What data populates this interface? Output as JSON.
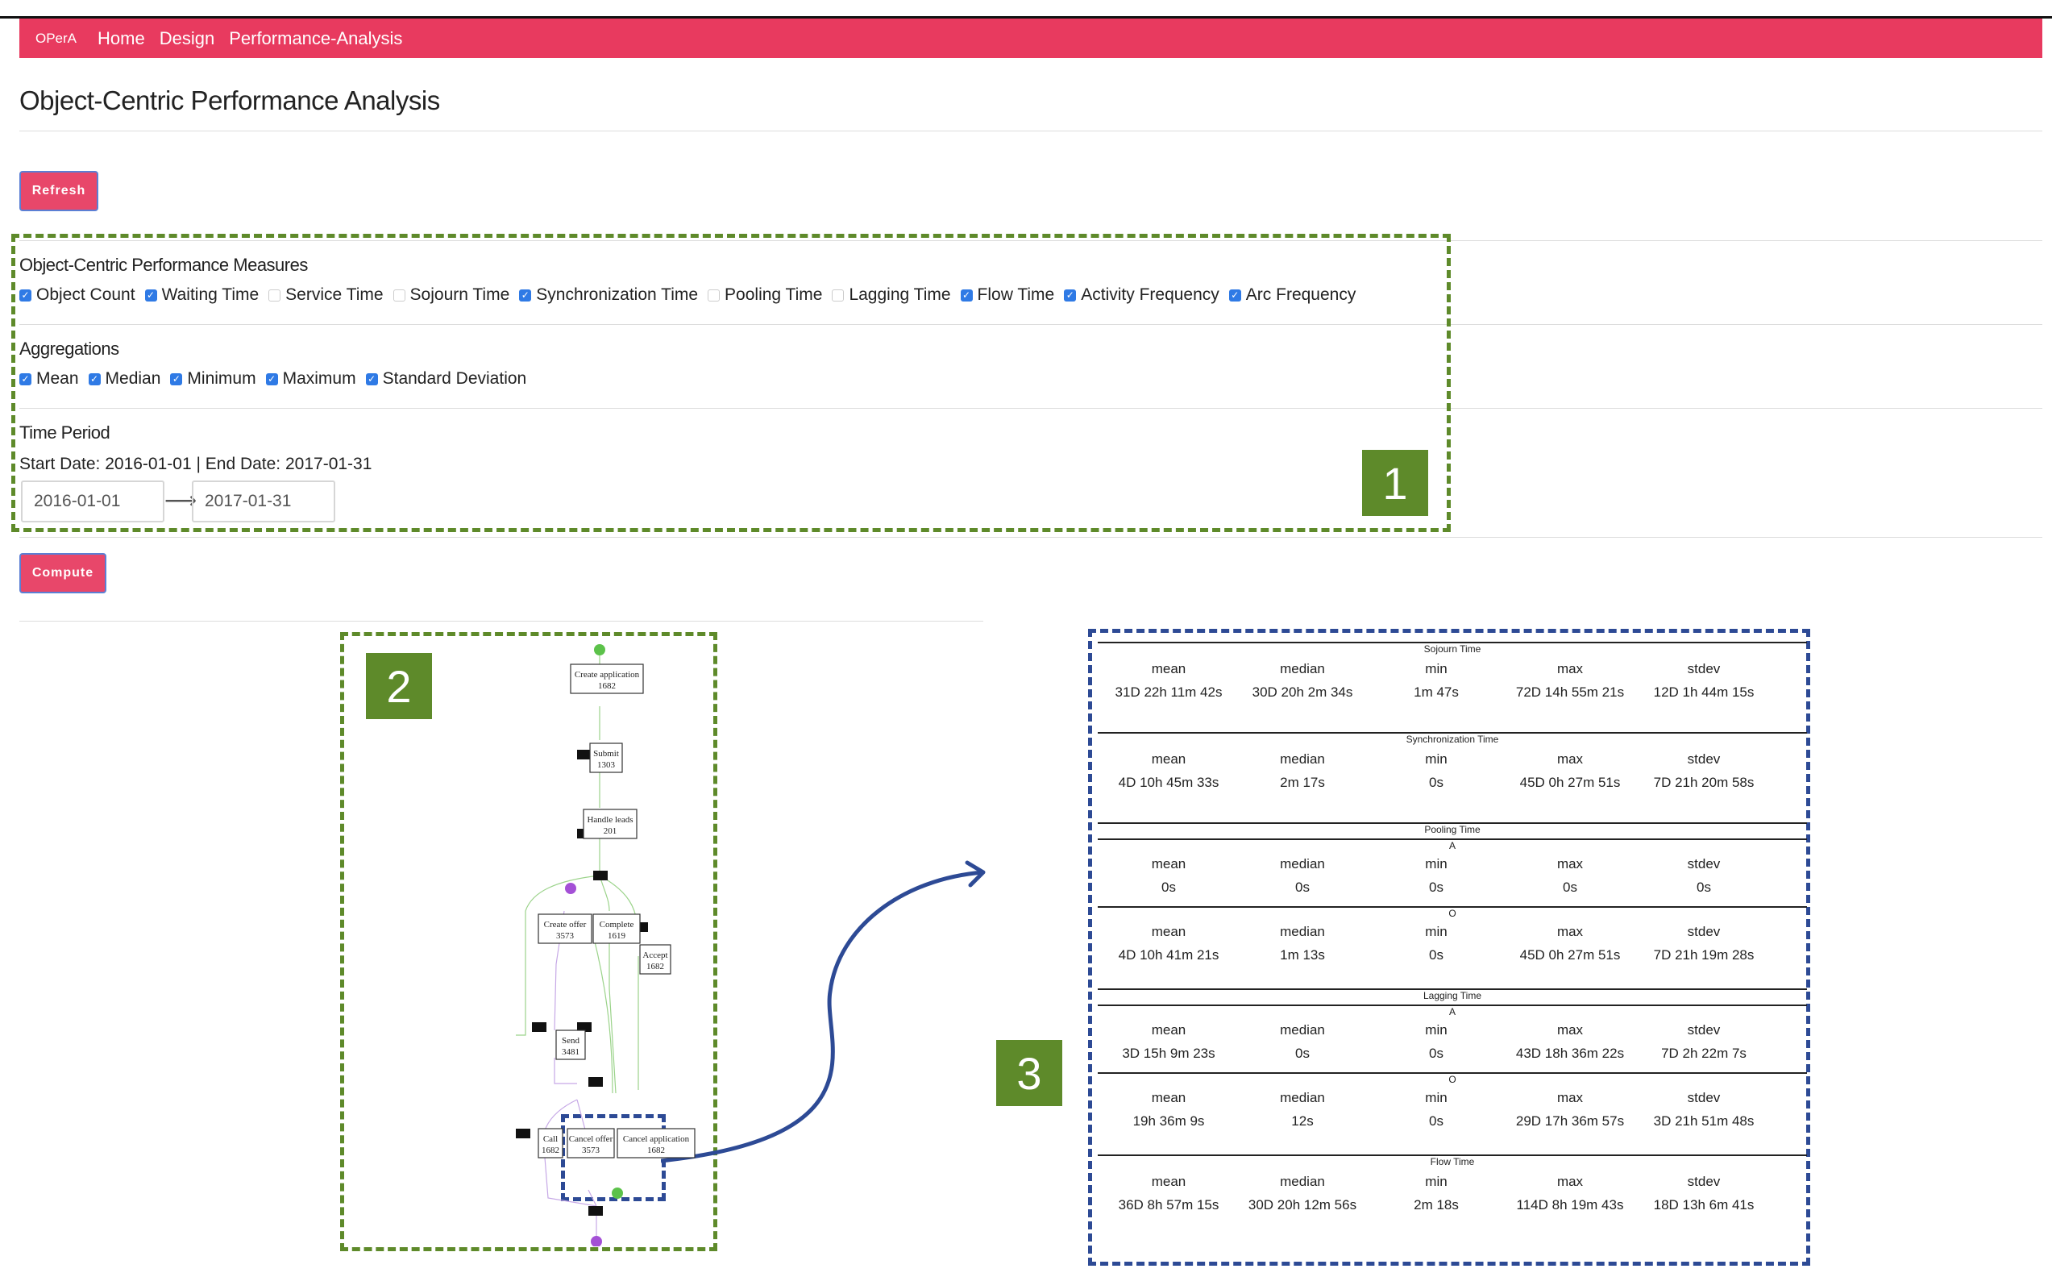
{
  "nav": {
    "brand": "OPerA",
    "links": [
      "Home",
      "Design",
      "Performance-Analysis"
    ]
  },
  "page_title": "Object-Centric Performance Analysis",
  "buttons": {
    "refresh": "Refresh",
    "compute": "Compute"
  },
  "measures": {
    "title": "Object-Centric Performance Measures",
    "items": [
      {
        "label": "Object Count",
        "checked": true
      },
      {
        "label": "Waiting Time",
        "checked": true
      },
      {
        "label": "Service Time",
        "checked": false
      },
      {
        "label": "Sojourn Time",
        "checked": false
      },
      {
        "label": "Synchronization Time",
        "checked": true
      },
      {
        "label": "Pooling Time",
        "checked": false
      },
      {
        "label": "Lagging Time",
        "checked": false
      },
      {
        "label": "Flow Time",
        "checked": true
      },
      {
        "label": "Activity Frequency",
        "checked": true
      },
      {
        "label": "Arc Frequency",
        "checked": true
      }
    ]
  },
  "aggregations": {
    "title": "Aggregations",
    "items": [
      {
        "label": "Mean",
        "checked": true
      },
      {
        "label": "Median",
        "checked": true
      },
      {
        "label": "Minimum",
        "checked": true
      },
      {
        "label": "Maximum",
        "checked": true
      },
      {
        "label": "Standard Deviation",
        "checked": true
      }
    ]
  },
  "time_period": {
    "title": "Time Period",
    "summary": "Start Date: 2016-01-01 | End Date: 2017-01-31",
    "start": "2016-01-01",
    "end": "2017-01-31"
  },
  "badges": [
    "1",
    "2",
    "3"
  ],
  "graph": {
    "nodes": [
      {
        "label": "Create application",
        "count": "1682"
      },
      {
        "label": "Submit",
        "count": "1303"
      },
      {
        "label": "Handle leads",
        "count": "201"
      },
      {
        "label": "Create offer",
        "count": "3573"
      },
      {
        "label": "Complete",
        "count": "1619"
      },
      {
        "label": "Accept",
        "count": "1682"
      },
      {
        "label": "Send",
        "count": "3481"
      },
      {
        "label": "Call",
        "count": "1682"
      },
      {
        "label": "Cancel offer",
        "count": "3573"
      },
      {
        "label": "Cancel application",
        "count": "1682"
      }
    ]
  },
  "performance": {
    "headers": [
      "mean",
      "median",
      "min",
      "max",
      "stdev"
    ],
    "sections": [
      {
        "title": "Sojourn Time",
        "groups": [
          {
            "sub": "",
            "values": [
              "31D 22h 11m 42s",
              "30D 20h 2m 34s",
              "1m 47s",
              "72D 14h 55m 21s",
              "12D 1h 44m 15s"
            ]
          }
        ]
      },
      {
        "title": "Synchronization Time",
        "groups": [
          {
            "sub": "",
            "values": [
              "4D 10h 45m 33s",
              "2m 17s",
              "0s",
              "45D 0h 27m 51s",
              "7D 21h 20m 58s"
            ]
          }
        ]
      },
      {
        "title": "Pooling Time",
        "groups": [
          {
            "sub": "A",
            "values": [
              "0s",
              "0s",
              "0s",
              "0s",
              "0s"
            ]
          },
          {
            "sub": "O",
            "values": [
              "4D 10h 41m 21s",
              "1m 13s",
              "0s",
              "45D 0h 27m 51s",
              "7D 21h 19m 28s"
            ]
          }
        ]
      },
      {
        "title": "Lagging Time",
        "groups": [
          {
            "sub": "A",
            "values": [
              "3D 15h 9m 23s",
              "0s",
              "0s",
              "43D 18h 36m 22s",
              "7D 2h 22m 7s"
            ]
          },
          {
            "sub": "O",
            "values": [
              "19h 36m 9s",
              "12s",
              "0s",
              "29D 17h 36m 57s",
              "3D 21h 51m 48s"
            ]
          }
        ]
      },
      {
        "title": "Flow Time",
        "groups": [
          {
            "sub": "",
            "values": [
              "36D 8h 57m 15s",
              "30D 20h 12m 56s",
              "2m 18s",
              "114D 8h 19m 43s",
              "18D 13h 6m 41s"
            ]
          }
        ]
      }
    ]
  },
  "colors": {
    "navbar": "#e83a5f",
    "button": "#e8476a",
    "checkbox": "#2f7ae5",
    "green_frame": "#5e8a2a",
    "blue_frame": "#2d4a95"
  }
}
